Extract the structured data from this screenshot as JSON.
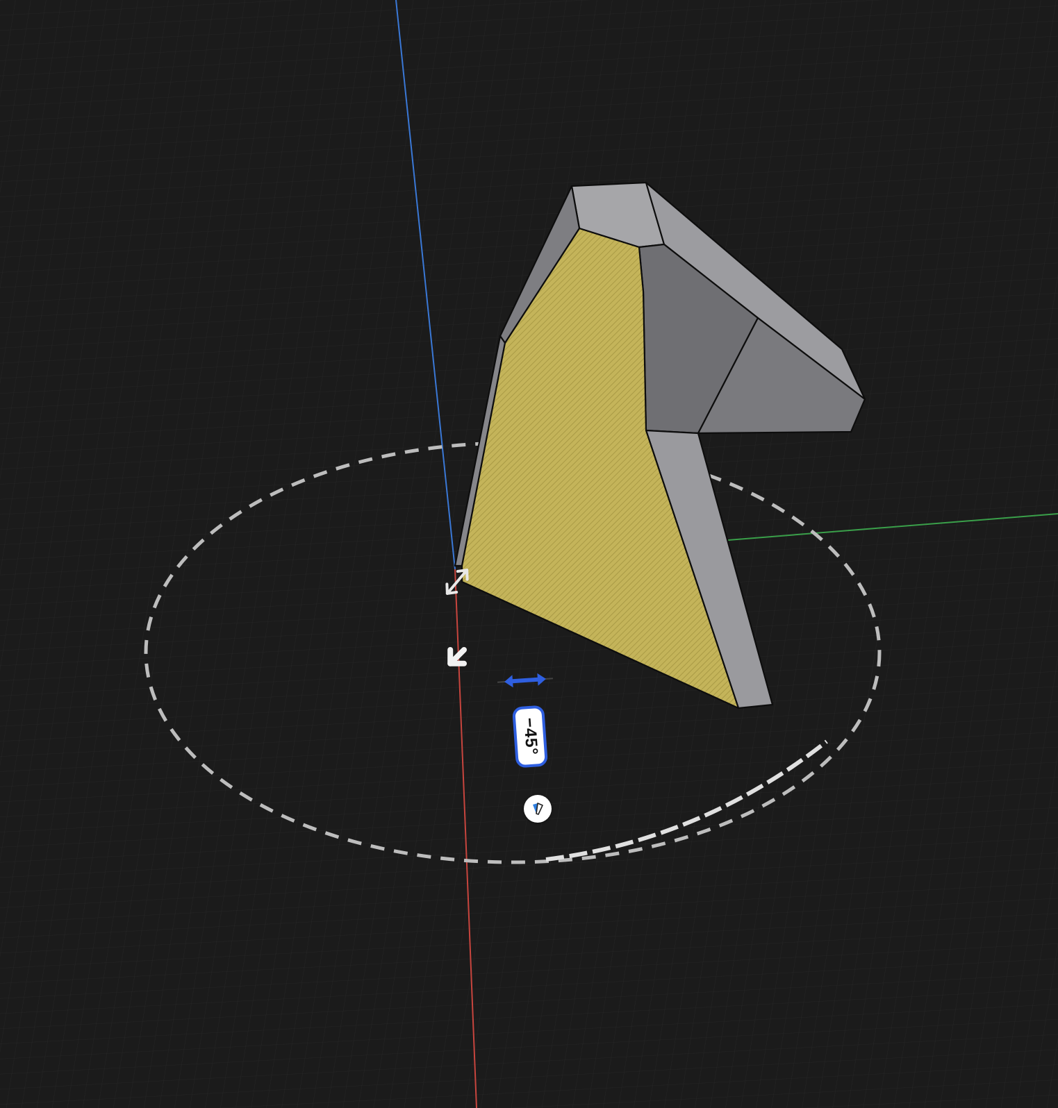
{
  "viewport": {
    "background": "#1b1b1b",
    "grid_color": "#2b2b2b"
  },
  "axes": {
    "x_color": "#c8453e",
    "y_color": "#3aa04a",
    "z_color": "#3a78d6"
  },
  "model": {
    "selected_face_color": "#c8b85a",
    "face_colors": [
      "#a3a3a6",
      "#8a8a8d",
      "#76767a",
      "#98989c"
    ]
  },
  "rotate_tool": {
    "angle_label": "−45°",
    "accent_color": "#2f5fe0",
    "icons": [
      "move-handle-icon",
      "direction-arrow-icon",
      "slide-arrows-icon",
      "snap-toggle-icon"
    ]
  }
}
